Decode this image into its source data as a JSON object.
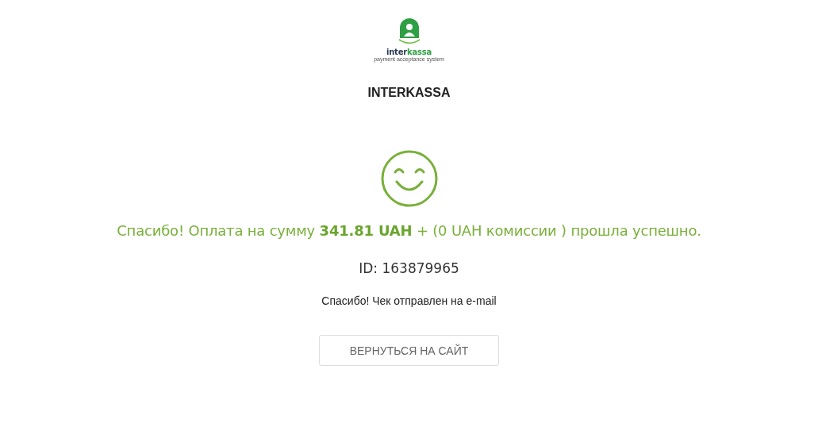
{
  "logo": {
    "name_dark": "inter",
    "name_green": "kassa",
    "tagline": "payment acceptance system"
  },
  "title": "INTERKASSA",
  "message": "Спасибо! Оплата на сумму **341.81 UAH** + (0 UAH комиссии ) прошла успешно.",
  "payment_id": "ID: 163879965",
  "note": "Спасибо! Чек отправлен на e-mail",
  "return_button": "ВЕРНУТЬСЯ НА САЙТ"
}
